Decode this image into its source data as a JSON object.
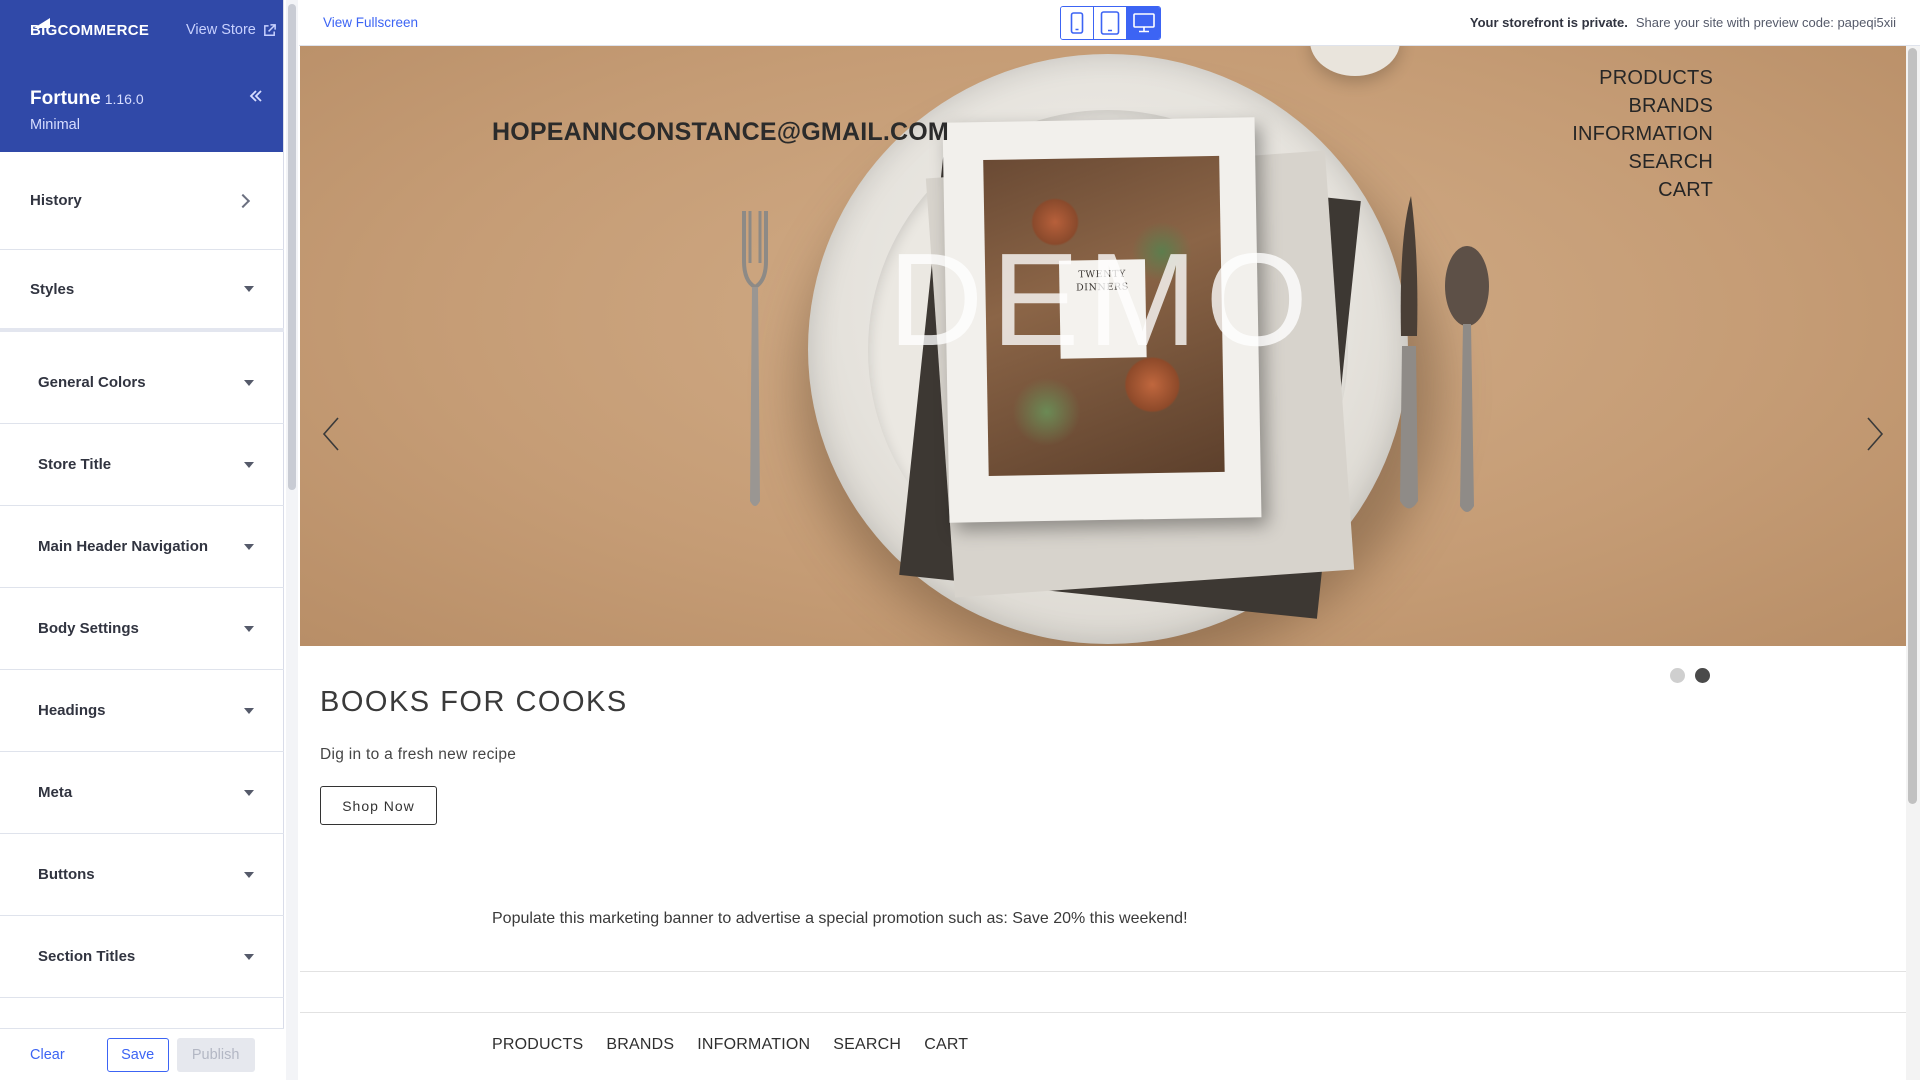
{
  "sidebar": {
    "logo_text": "BIGCOMMERCE",
    "view_store_label": "View Store",
    "theme": {
      "name": "Fortune",
      "version": "1.16.0",
      "variant": "Minimal"
    },
    "history_label": "History",
    "styles_label": "Styles",
    "settings": [
      {
        "label": "General Colors"
      },
      {
        "label": "Store Title"
      },
      {
        "label": "Main Header Navigation"
      },
      {
        "label": "Body Settings"
      },
      {
        "label": "Headings"
      },
      {
        "label": "Meta"
      },
      {
        "label": "Buttons"
      },
      {
        "label": "Section Titles"
      }
    ],
    "footer": {
      "clear_label": "Clear",
      "save_label": "Save",
      "publish_label": "Publish"
    }
  },
  "topbar": {
    "view_fullscreen_label": "View Fullscreen",
    "devices": [
      "mobile-icon",
      "tablet-icon",
      "desktop-icon"
    ],
    "active_device": "desktop",
    "private_notice": "Your storefront is private.",
    "share_notice": "Share your site with preview code: papeqi5xii"
  },
  "preview": {
    "store_title": "HOPEANNCONSTANCE@GMAIL.COM",
    "nav": [
      "PRODUCTS",
      "BRANDS",
      "INFORMATION",
      "SEARCH",
      "CART"
    ],
    "hero_watermark": "DEMO",
    "book_cover_text": "TWENTY DINNERS",
    "carousel": {
      "slide_count": 2,
      "active_slide": 2
    },
    "slide_title": "BOOKS FOR COOKS",
    "slide_subtitle": "Dig in to a fresh new recipe",
    "slide_button": "Shop Now",
    "promo_banner": "Populate this marketing banner to advertise a special promotion such as: Save 20% this weekend!",
    "footer_nav": [
      "PRODUCTS",
      "BRANDS",
      "INFORMATION",
      "SEARCH",
      "CART"
    ]
  },
  "colors": {
    "brand_header": "#3049a8",
    "accent": "#3c64f4",
    "hero_background": "#c8a07a"
  }
}
